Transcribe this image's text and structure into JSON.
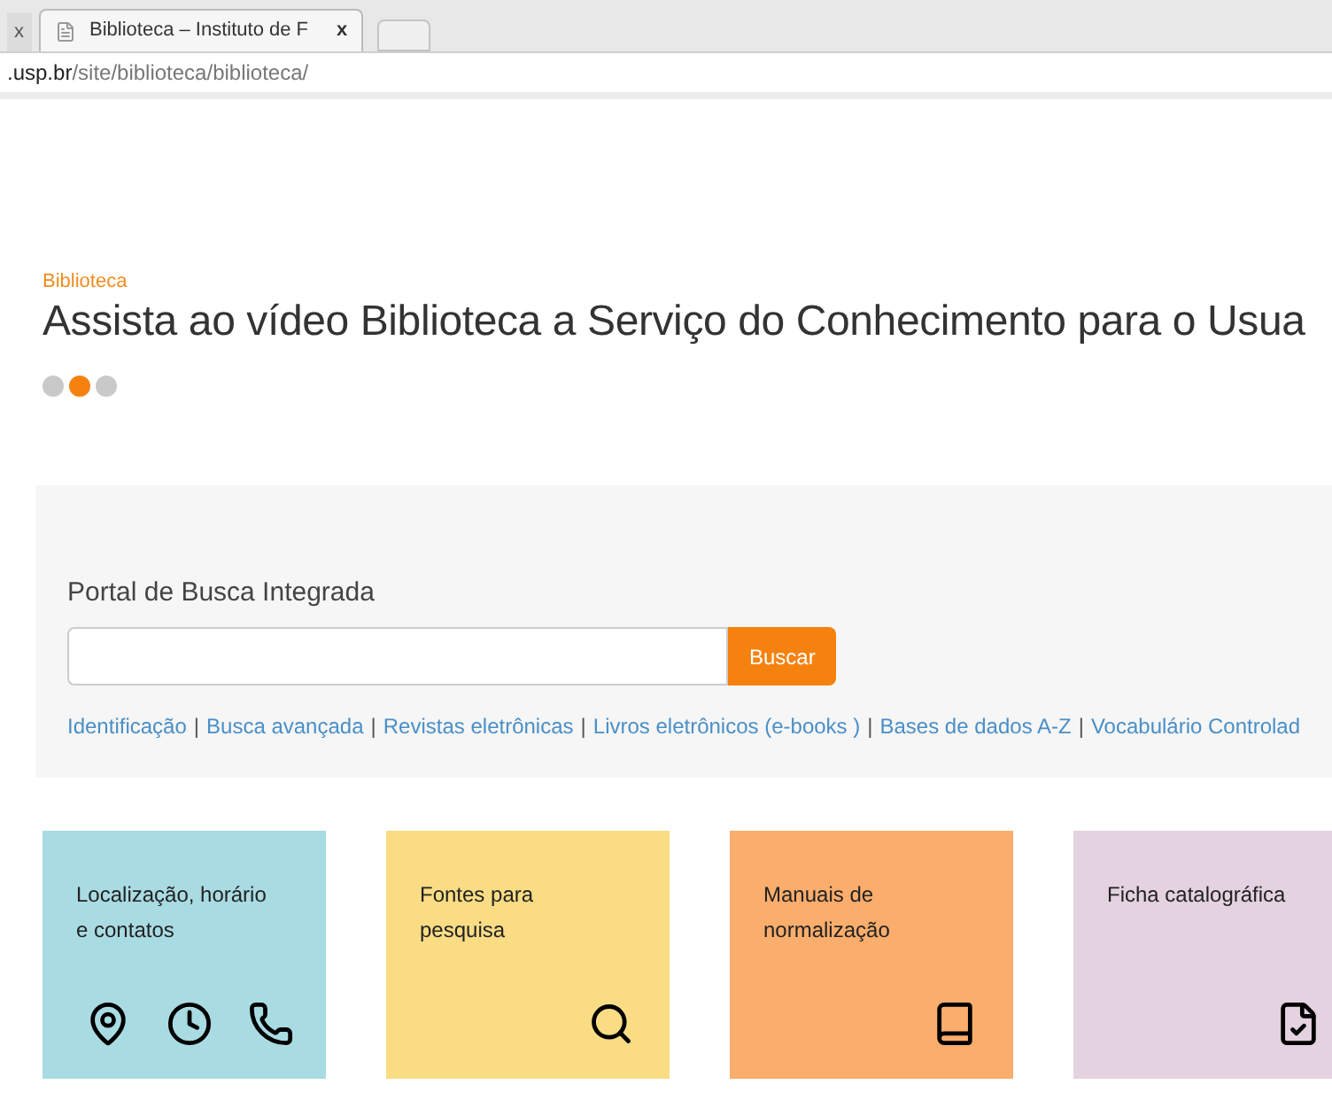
{
  "browser": {
    "tabs": [
      {
        "title": "x",
        "selected": false
      },
      {
        "title": "Biblioteca – Instituto de F",
        "selected": true
      }
    ],
    "close_label": "x",
    "address_host": ".usp.br",
    "address_path": "/site/biblioteca/biblioteca/"
  },
  "carousel": {
    "category": "Biblioteca",
    "headline": "Assista ao vídeo Biblioteca a Serviço do Conhecimento para o Usua",
    "dots": [
      {
        "selected": false
      },
      {
        "selected": true
      },
      {
        "selected": false
      }
    ]
  },
  "search": {
    "title": "Portal de Busca Integrada",
    "button": "Buscar",
    "links": [
      "Identificação",
      "Busca avançada",
      "Revistas eletrônicas",
      "Livros eletrônicos (e-books )",
      "Bases de dados A-Z",
      "Vocabulário Controlad"
    ],
    "separator": "|"
  },
  "tiles": [
    {
      "title": "Localização, horário e contatos",
      "color": "#a9dbe3",
      "icons": [
        {
          "kind": "pin"
        },
        {
          "kind": "clock"
        },
        {
          "kind": "phone"
        }
      ]
    },
    {
      "title": "Fontes para pesquisa",
      "color": "#f9dc84",
      "icons": [
        {
          "kind": "search"
        }
      ]
    },
    {
      "title": "Manuais de normalização",
      "color": "#faad6c",
      "icons": [
        {
          "kind": "book"
        }
      ]
    },
    {
      "title": "Ficha catalográfica",
      "color": "#e4d2e0",
      "icons": [
        {
          "kind": "checklist"
        }
      ]
    }
  ]
}
